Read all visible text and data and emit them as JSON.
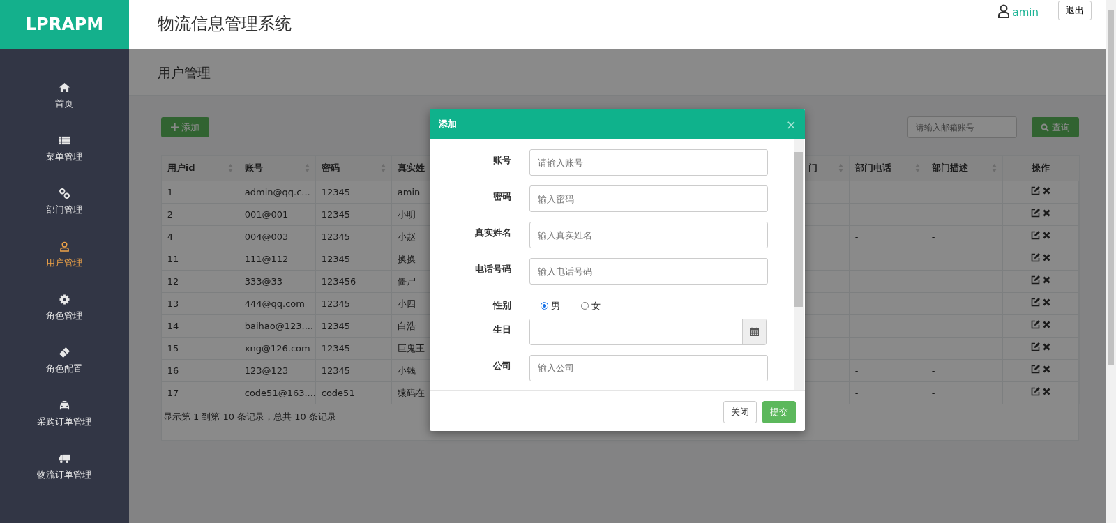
{
  "header": {
    "logo": "LPRAPM",
    "title": "物流信息管理系统",
    "user": "amin",
    "logout": "退出"
  },
  "sidebar": {
    "items": [
      {
        "label": "首页",
        "kind": "home",
        "selected": false
      },
      {
        "label": "菜单管理",
        "kind": "list",
        "selected": false
      },
      {
        "label": "部门管理",
        "kind": "link",
        "selected": false
      },
      {
        "label": "用户管理",
        "kind": "user",
        "selected": true
      },
      {
        "label": "角色管理",
        "kind": "gear",
        "selected": false
      },
      {
        "label": "角色配置",
        "kind": "ticket",
        "selected": false
      },
      {
        "label": "采购订单管理",
        "kind": "car",
        "selected": false
      },
      {
        "label": "物流订单管理",
        "kind": "truck",
        "selected": false
      }
    ]
  },
  "page_title": "用户管理",
  "toolbar": {
    "add_button": "添加",
    "search": {
      "placeholder": "请输入邮箱账号"
    },
    "search_button": "查询"
  },
  "table": {
    "columns": [
      {
        "label": "用户id",
        "sortable": true
      },
      {
        "label": "账号",
        "sortable": true
      },
      {
        "label": "密码",
        "sortable": true
      },
      {
        "label": "真实姓"
      },
      {
        "label": "门",
        "sortable": true
      },
      {
        "label": "部门电话",
        "sortable": true
      },
      {
        "label": "部门描述",
        "sortable": true
      },
      {
        "label": "操作",
        "sortable": false
      }
    ],
    "rows": [
      {
        "user_id": "1",
        "account": "admin@qq.c...",
        "password": "12345",
        "real_name": "amin"
      },
      {
        "user_id": "2",
        "account": "001@001",
        "password": "12345",
        "real_name": "小明",
        "dept_phone": "-",
        "dept_desc": "-"
      },
      {
        "user_id": "4",
        "account": "004@003",
        "password": "12345",
        "real_name": "小赵",
        "dept_phone": "-",
        "dept_desc": "-"
      },
      {
        "user_id": "11",
        "account": "111@112",
        "password": "12345",
        "real_name": "换换"
      },
      {
        "user_id": "12",
        "account": "333@33",
        "password": "123456",
        "real_name": "僵尸"
      },
      {
        "user_id": "13",
        "account": "444@qq.com",
        "password": "12345",
        "real_name": "小四"
      },
      {
        "user_id": "14",
        "account": "baihao@123....",
        "password": "12345",
        "real_name": "白浩"
      },
      {
        "user_id": "15",
        "account": "xng@126.com",
        "password": "12345",
        "real_name": "巨鬼王"
      },
      {
        "user_id": "16",
        "account": "123@123",
        "password": "12345",
        "real_name": "小钱",
        "dept_phone": "-",
        "dept_desc": "-"
      },
      {
        "user_id": "17",
        "account": "code51@163....",
        "password": "code51",
        "real_name": "猿码在",
        "dept_phone": "-",
        "dept_desc": "-"
      }
    ],
    "footer": "显示第 1 到第 10 条记录，总共 10 条记录"
  },
  "modal": {
    "title": "添加",
    "close": "×",
    "fields": [
      {
        "kind": "text",
        "label": "账号",
        "placeholder": "请输入账号"
      },
      {
        "kind": "text",
        "label": "密码",
        "placeholder": "输入密码"
      },
      {
        "kind": "text",
        "label": "真实姓名",
        "placeholder": "输入真实姓名"
      },
      {
        "kind": "text",
        "label": "电话号码",
        "placeholder": "输入电话号码"
      },
      {
        "kind": "radio",
        "label": "性别",
        "options": [
          {
            "label": "男",
            "selected": true
          },
          {
            "label": "女",
            "selected": false
          }
        ]
      },
      {
        "kind": "date",
        "label": "生日"
      },
      {
        "kind": "text",
        "label": "公司",
        "placeholder": "输入公司"
      }
    ],
    "buttons": [
      {
        "label": "关闭",
        "kind": "default"
      },
      {
        "label": "提交",
        "kind": "primary"
      }
    ]
  }
}
